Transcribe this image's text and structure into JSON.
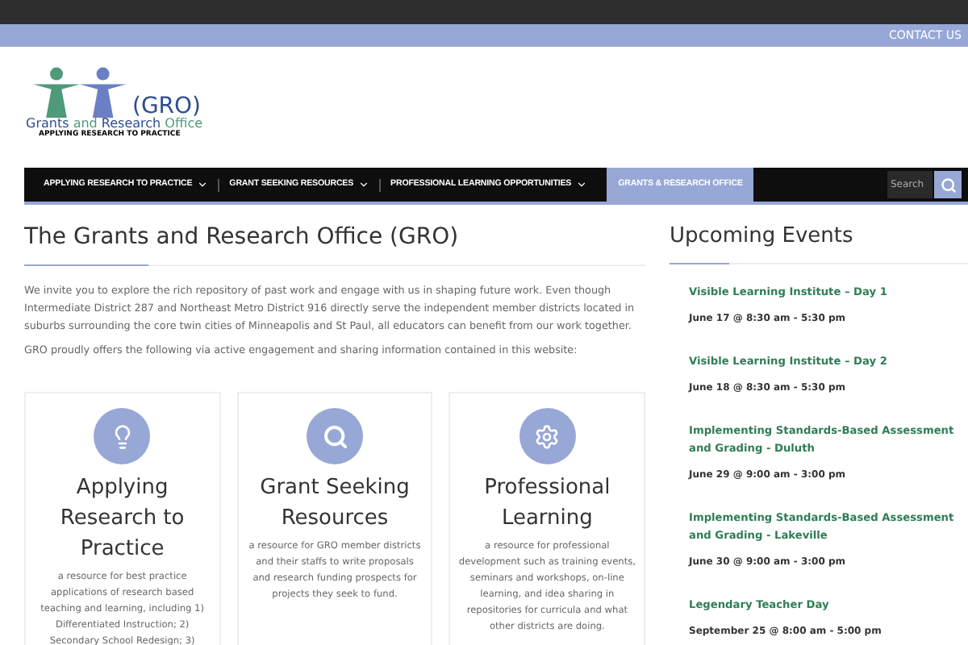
{
  "top_bar": {
    "link": "CONTACT US"
  },
  "logo": {
    "acronym": "(GRO)",
    "name_part1": "Grants",
    "name_part2": "and",
    "name_part3": "Research",
    "name_part4": "Office",
    "tagline": "APPLYING RESEARCH TO PRACTICE"
  },
  "nav": {
    "items": [
      {
        "label": "APPLYING RESEARCH TO PRACTICE",
        "has_menu": true,
        "selected": false
      },
      {
        "label": "GRANT SEEKING RESOURCES",
        "has_menu": true,
        "selected": false
      },
      {
        "label": "PROFESSIONAL LEARNING OPPORTUNITIES",
        "has_menu": true,
        "selected": false
      },
      {
        "label": "GRANTS & RESEARCH OFFICE",
        "has_menu": false,
        "selected": true
      }
    ],
    "search": {
      "placeholder": "Search"
    }
  },
  "main": {
    "title": "The Grants and Research Office (GRO)",
    "paragraphs": [
      "We invite you to explore the rich repository of past work and engage with us in shaping future work. Even though Intermediate District 287 and Northeast Metro District 916 directly serve the independent member districts located in suburbs surrounding the core twin cities of Minneapolis and St Paul, all educators can benefit from our work together.",
      "GRO proudly offers the following via active engagement and sharing information contained in this website:"
    ],
    "cards": [
      {
        "kind": "bulb",
        "title": "Applying Research to Practice",
        "text": "a resource for best practice applications of research based teaching and learning, including 1) Differentiated Instruction; 2) Secondary School Redesign; 3)"
      },
      {
        "kind": "search",
        "title": "Grant Seeking Resources",
        "text": "a resource for GRO member districts and their staffs to write proposals and research funding prospects for projects they seek to fund."
      },
      {
        "kind": "gear",
        "title": "Professional Learning",
        "text": "a resource for professional development such as training events, seminars and workshops, on-line learning, and idea sharing in repositories for curricula and what other districts are doing."
      }
    ]
  },
  "sidebar": {
    "title": "Upcoming Events",
    "events": [
      {
        "title": "Visible Learning Institute – Day 1",
        "date": "June 17 @ 8:30 am - 5:30 pm"
      },
      {
        "title": "Visible Learning Institute – Day 2",
        "date": "June 18 @ 8:30 am - 5:30 pm"
      },
      {
        "title": "Implementing Standards-Based Assessment and Grading - Duluth",
        "date": "June 29 @ 9:00 am - 3:00 pm"
      },
      {
        "title": "Implementing Standards-Based Assessment and Grading - Lakeville",
        "date": "June 30 @ 9:00 am - 3:00 pm"
      },
      {
        "title": "Legendary Teacher Day",
        "date": "September 25 @ 8:00 am - 5:00 pm"
      }
    ]
  }
}
